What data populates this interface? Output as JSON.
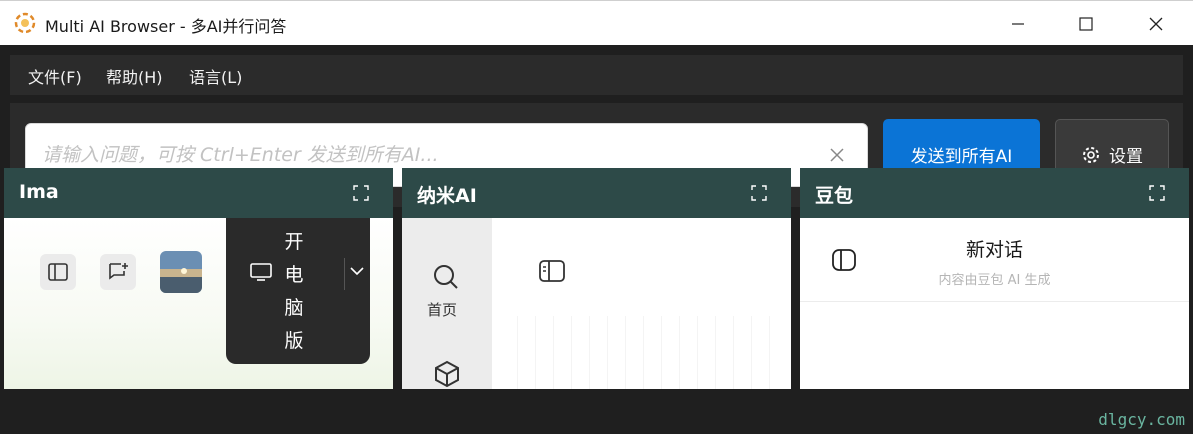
{
  "window": {
    "title": "Multi AI Browser - 多AI并行问答"
  },
  "menu": {
    "items": [
      "文件(F)",
      "帮助(H)",
      "语言(L)"
    ]
  },
  "toolbar": {
    "input_placeholder": "请输入问题，可按 Ctrl+Enter 发送到所有AI...",
    "input_value": "",
    "send_label": "发送到所有AI",
    "settings_label": "设置"
  },
  "panels": [
    {
      "title": "Ima",
      "desktop_label": "开电脑版"
    },
    {
      "title": "纳米AI",
      "home_label": "首页"
    },
    {
      "title": "豆包",
      "chat_title": "新对话",
      "chat_subtitle": "内容由豆包 AI 生成"
    }
  ],
  "watermark": "dlgcy.com",
  "colors": {
    "panel_header": "#2d4a48",
    "send_button": "#0b74d6",
    "app_background": "#1f1f1f"
  }
}
